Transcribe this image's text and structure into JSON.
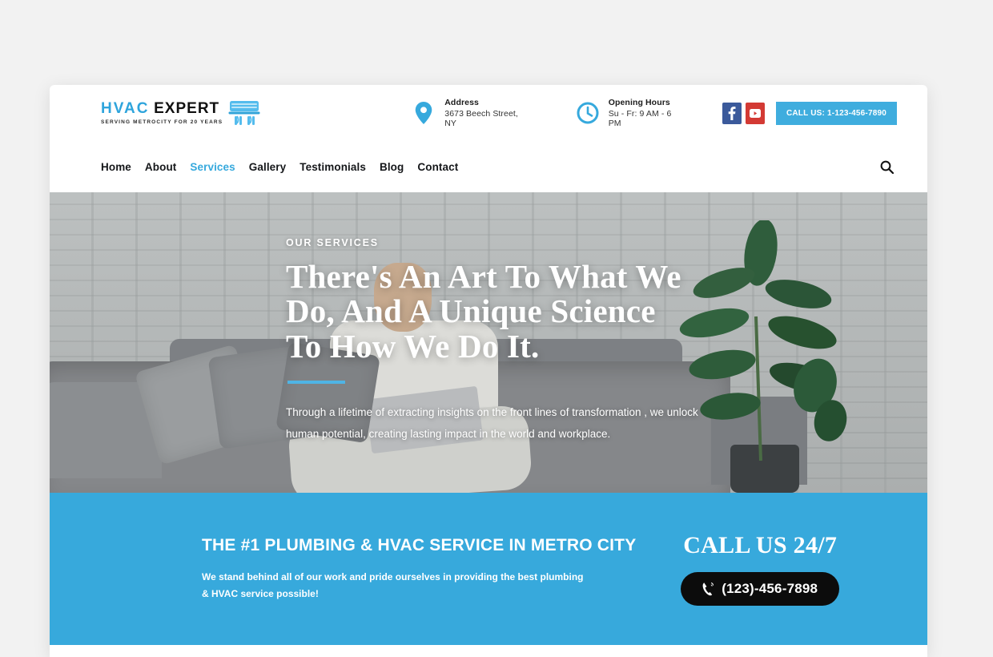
{
  "header": {
    "logo": {
      "title_primary": "HVAC",
      "title_secondary": "EXPERT",
      "tagline": "SERVING METROCITY FOR 20 YEARS",
      "icon": "air-conditioner-icon"
    },
    "address": {
      "icon": "map-pin-icon",
      "title": "Address",
      "value": "3673 Beech Street, NY"
    },
    "hours": {
      "icon": "clock-icon",
      "title": "Opening Hours",
      "value": "Su - Fr: 9 AM - 6 PM"
    },
    "social": [
      {
        "name": "facebook-icon",
        "label": "f",
        "color": "#3b5a9b"
      },
      {
        "name": "youtube-icon",
        "label": "▶",
        "color": "#d33a34"
      }
    ],
    "call_button": "CALL US: 1-123-456-7890",
    "search_icon": "search-icon",
    "nav": [
      {
        "label": "Home",
        "active": false
      },
      {
        "label": "About",
        "active": false
      },
      {
        "label": "Services",
        "active": true
      },
      {
        "label": "Gallery",
        "active": false
      },
      {
        "label": "Testimonials",
        "active": false
      },
      {
        "label": "Blog",
        "active": false
      },
      {
        "label": "Contact",
        "active": false
      }
    ]
  },
  "hero": {
    "eyebrow": "OUR SERVICES",
    "title_line1": "There's An Art To What We",
    "title_line2": "Do, And A Unique Science",
    "title_line3": "To How We Do It.",
    "paragraph": "Through a lifetime of extracting insights on the front lines of transformation , we unlock human potential, creating lasting impact in the world and workplace."
  },
  "cta": {
    "heading": "THE #1 PLUMBING & HVAC SERVICE IN METRO CITY",
    "subtext": "We stand behind all of our work and pride ourselves in providing the best plumbing & HVAC service possible!",
    "call_title": "CALL US 24/7",
    "phone_number": "(123)-456-7898",
    "phone_icon": "phone-icon"
  },
  "colors": {
    "accent_blue": "#37a9dc",
    "logo_blue": "#2ea4dc",
    "nav_active": "#36a9dd",
    "facebook": "#3b5a9b",
    "youtube": "#d33a34",
    "phone_button": "#0c0c0c",
    "page_background": "#f2f2f2"
  }
}
